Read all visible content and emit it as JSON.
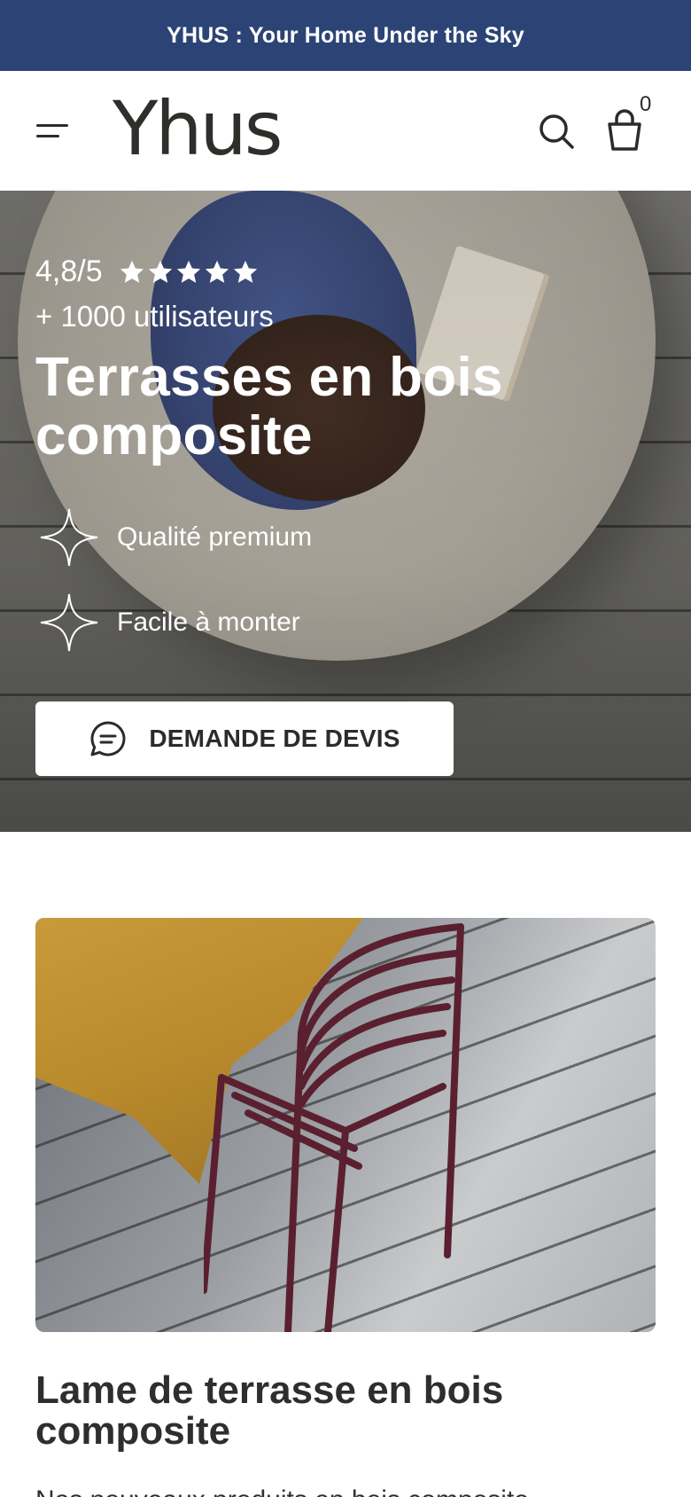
{
  "announcement": {
    "text": "YHUS : Your Home Under the Sky"
  },
  "header": {
    "logo": "Yhus",
    "menu_icon": "hamburger-menu-icon",
    "search_icon": "search-icon",
    "cart_icon": "shopping-bag-icon",
    "cart_count": "0"
  },
  "hero": {
    "rating": "4,8/5",
    "stars": 5,
    "users": "+ 1000 utilisateurs",
    "title": "Terrasses en bois composite",
    "features": [
      {
        "icon": "sparkle-icon",
        "label": "Qualité premium"
      },
      {
        "icon": "sparkle-icon",
        "label": "Facile à monter"
      }
    ],
    "cta": {
      "icon": "chat-bubble-icon",
      "label": "DEMANDE DE DEVIS"
    }
  },
  "section": {
    "title": "Lame de terrasse en bois composite",
    "text": "Nos nouveaux produits en bois composite"
  },
  "colors": {
    "announcement_bg": "#2c4475",
    "text": "#2b2b2b",
    "hero_text": "#ffffff"
  }
}
